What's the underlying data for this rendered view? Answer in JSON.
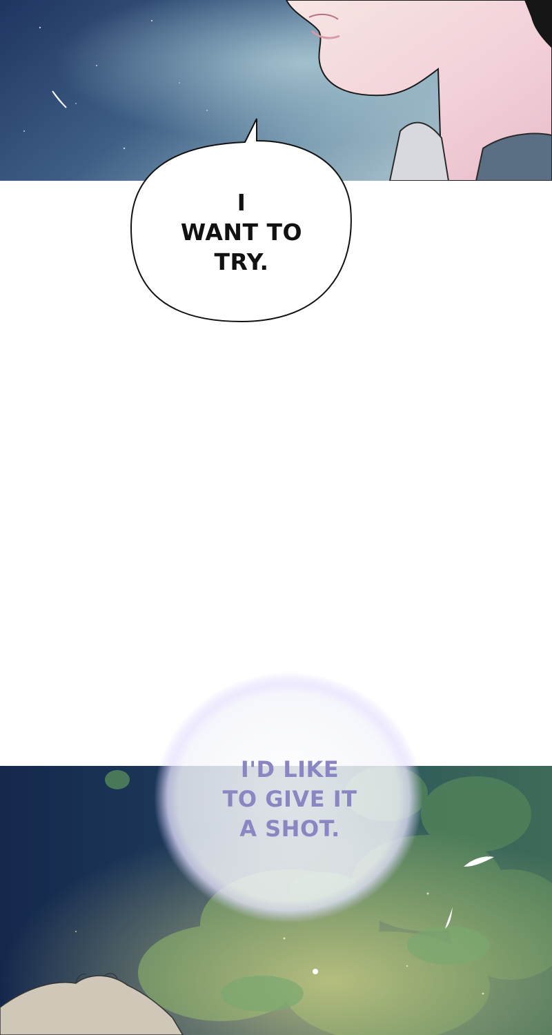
{
  "colors": {
    "night_sky_dark": "#1b2f55",
    "night_sky_light": "#6b8ea8",
    "skin": "#f3dadd",
    "page_background": "#ffffff",
    "foliage": "#5e8a62",
    "glow_text": "#8a86c4",
    "speech_text": "#111111"
  },
  "speech_bubble": {
    "lines": [
      "I",
      "WANT TO",
      "TRY."
    ]
  },
  "glow_bubble": {
    "lines": [
      "I'D LIKE",
      "TO GIVE IT",
      "A SHOT."
    ]
  }
}
